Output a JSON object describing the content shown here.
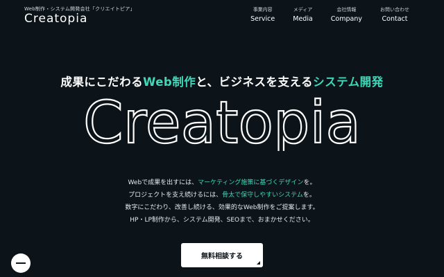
{
  "header": {
    "tagline": "Web制作・システム開発会社「クリエイトピア」",
    "logo": "Creatopia"
  },
  "nav": [
    {
      "jp": "事業内容",
      "en": "Service"
    },
    {
      "jp": "メディア",
      "en": "Media"
    },
    {
      "jp": "会社情報",
      "en": "Company"
    },
    {
      "jp": "お問い合わせ",
      "en": "Contact"
    }
  ],
  "hero": {
    "headline_1": "成果にこだわる",
    "headline_accent_1": "Web制作",
    "headline_2": "と、ビジネスを支える",
    "headline_accent_2": "システム開発",
    "logo": "Creatopia",
    "accent_color": "#3fd7b8",
    "lines": [
      {
        "a": "Webで成果を出すには、",
        "b": "マーケティング施策に基づくデザイン",
        "c": "を。"
      },
      {
        "a": "プロジェクトを支え続けるには、",
        "b": "骨太で保守しやすいシステム",
        "c": "を。"
      }
    ],
    "line3": "数字にこだわり、改善し続ける、効果的なWeb制作をご提案します。",
    "line4": "HP・LP制作から、システム開発、SEOまで、おまかせください。",
    "cta": "無料相談する"
  },
  "icons": {
    "menu": "menu-icon",
    "arrow": "corner-arrow-icon"
  }
}
